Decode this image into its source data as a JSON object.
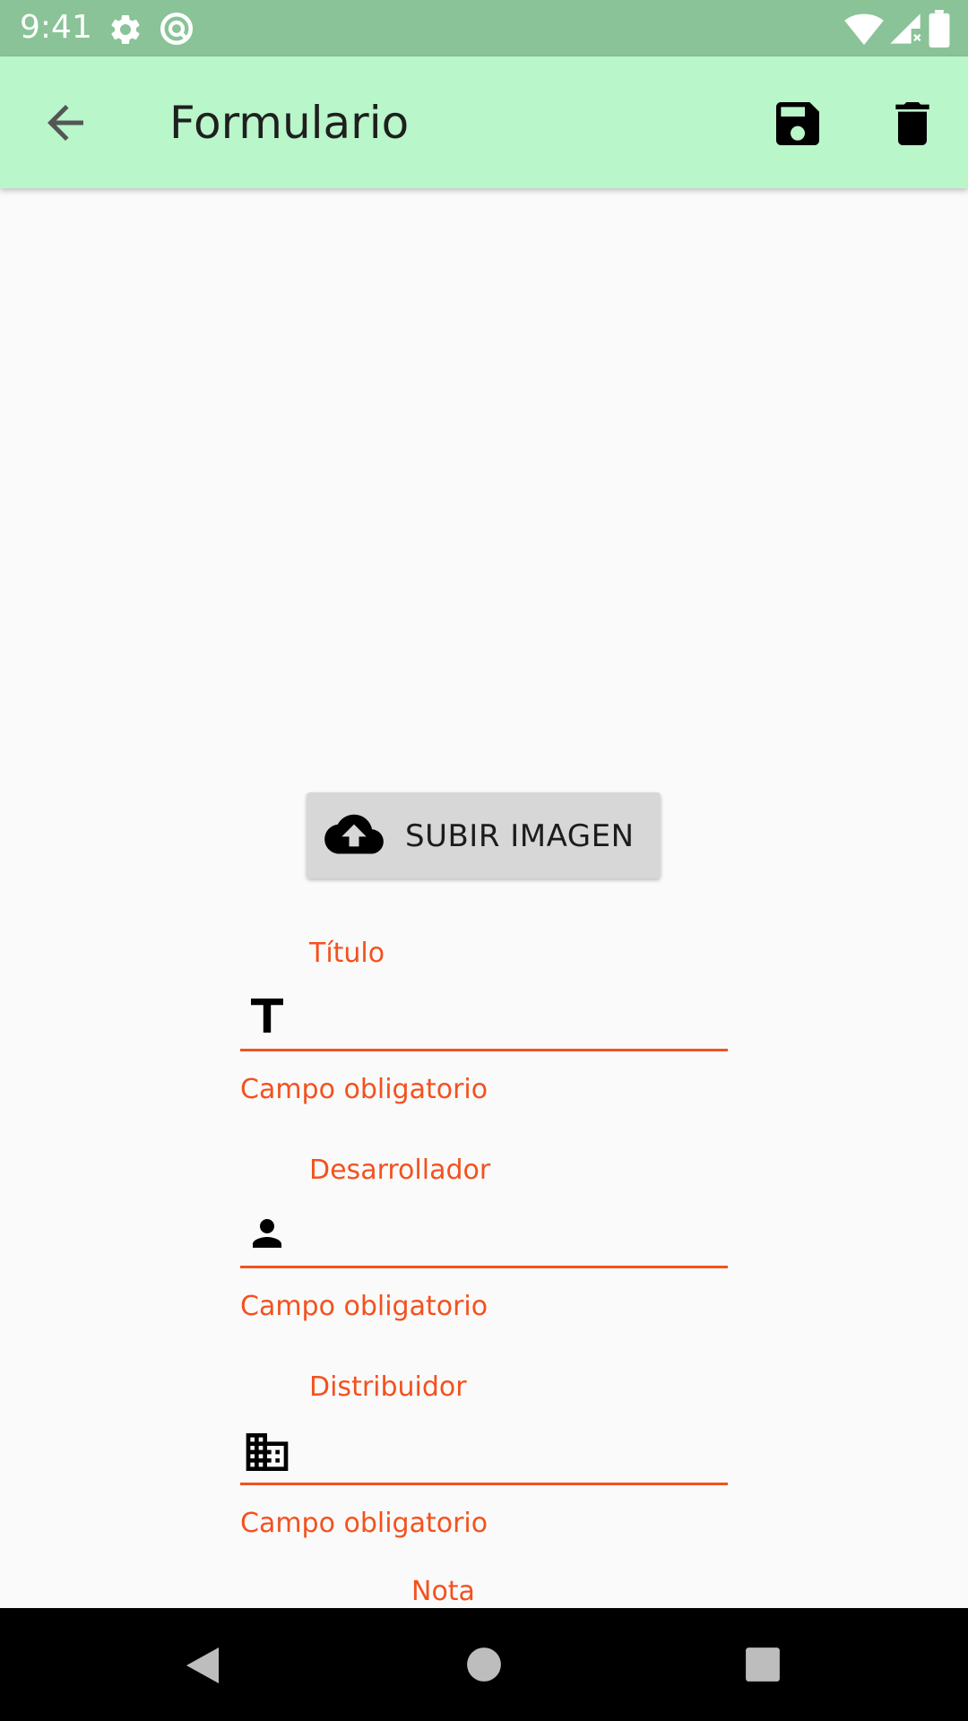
{
  "status_bar": {
    "time": "9:41",
    "icons": [
      "gear-icon",
      "sync-icon",
      "wifi-icon",
      "signal-icon",
      "battery-icon"
    ],
    "color": "#89c397"
  },
  "app_bar": {
    "title": "Formulario",
    "actions": [
      "back-arrow-icon",
      "save-icon",
      "delete-icon"
    ],
    "color": "#b9f6ca"
  },
  "upload": {
    "label": "SUBIR IMAGEN",
    "icon": "cloud-upload-icon"
  },
  "form": {
    "accent_color": "#f4511e",
    "fields": [
      {
        "label": "Título",
        "icon": "title-text-icon",
        "value": "",
        "error": "Campo obligatorio"
      },
      {
        "label": "Desarrollador",
        "icon": "person-icon",
        "value": "",
        "error": "Campo obligatorio"
      },
      {
        "label": "Distribuidor",
        "icon": "business-icon",
        "value": "",
        "error": "Campo obligatorio"
      }
    ],
    "next_field_label": "Nota"
  },
  "nav_bar": {
    "buttons": [
      "back-triangle-icon",
      "home-circle-icon",
      "recents-square-icon"
    ]
  }
}
